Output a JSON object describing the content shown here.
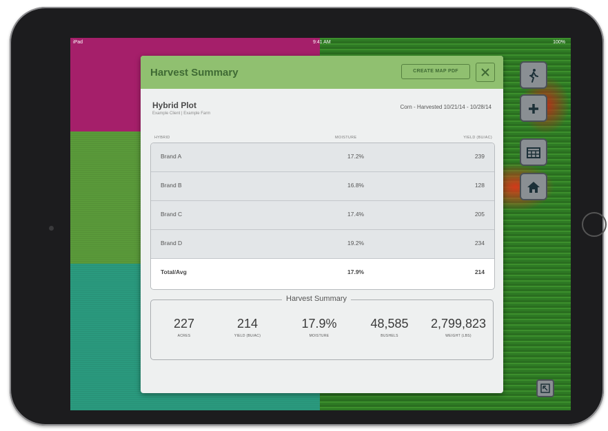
{
  "status_bar": {
    "left": "iPad",
    "time": "9:41 AM",
    "battery": "100%"
  },
  "side_buttons": [
    {
      "icon": "walk-icon"
    },
    {
      "icon": "plus-icon"
    },
    {
      "icon": "calendar-icon"
    },
    {
      "icon": "home-icon"
    }
  ],
  "corner_button": {
    "icon": "collapse-icon"
  },
  "modal": {
    "title": "Harvest Summary",
    "create_pdf_label": "CREATE MAP PDF",
    "plot_name": "Hybrid Plot",
    "plot_subtitle": "Example Client | Example Farm",
    "crop_info": "Corn - Harvested 10/21/14 - 10/28/14",
    "table": {
      "columns": [
        "HYBRID",
        "MOISTURE",
        "YIELD (BU/AC)"
      ],
      "rows": [
        {
          "hybrid": "Brand A",
          "moisture": "17.2%",
          "yield": "239"
        },
        {
          "hybrid": "Brand B",
          "moisture": "16.8%",
          "yield": "128"
        },
        {
          "hybrid": "Brand C",
          "moisture": "17.4%",
          "yield": "205"
        },
        {
          "hybrid": "Brand D",
          "moisture": "19.2%",
          "yield": "234"
        },
        {
          "hybrid": "Total/Avg",
          "moisture": "17.9%",
          "yield": "214"
        }
      ]
    },
    "summary": {
      "title": "Harvest Summary",
      "stats": [
        {
          "value": "227",
          "label": "ACRES"
        },
        {
          "value": "214",
          "label": "YIELD (BU/AC)"
        },
        {
          "value": "17.9%",
          "label": "MOISTURE"
        },
        {
          "value": "48,585",
          "label": "BUSHELS"
        },
        {
          "value": "2,799,823",
          "label": "WEIGHT (LBS)"
        }
      ]
    }
  }
}
